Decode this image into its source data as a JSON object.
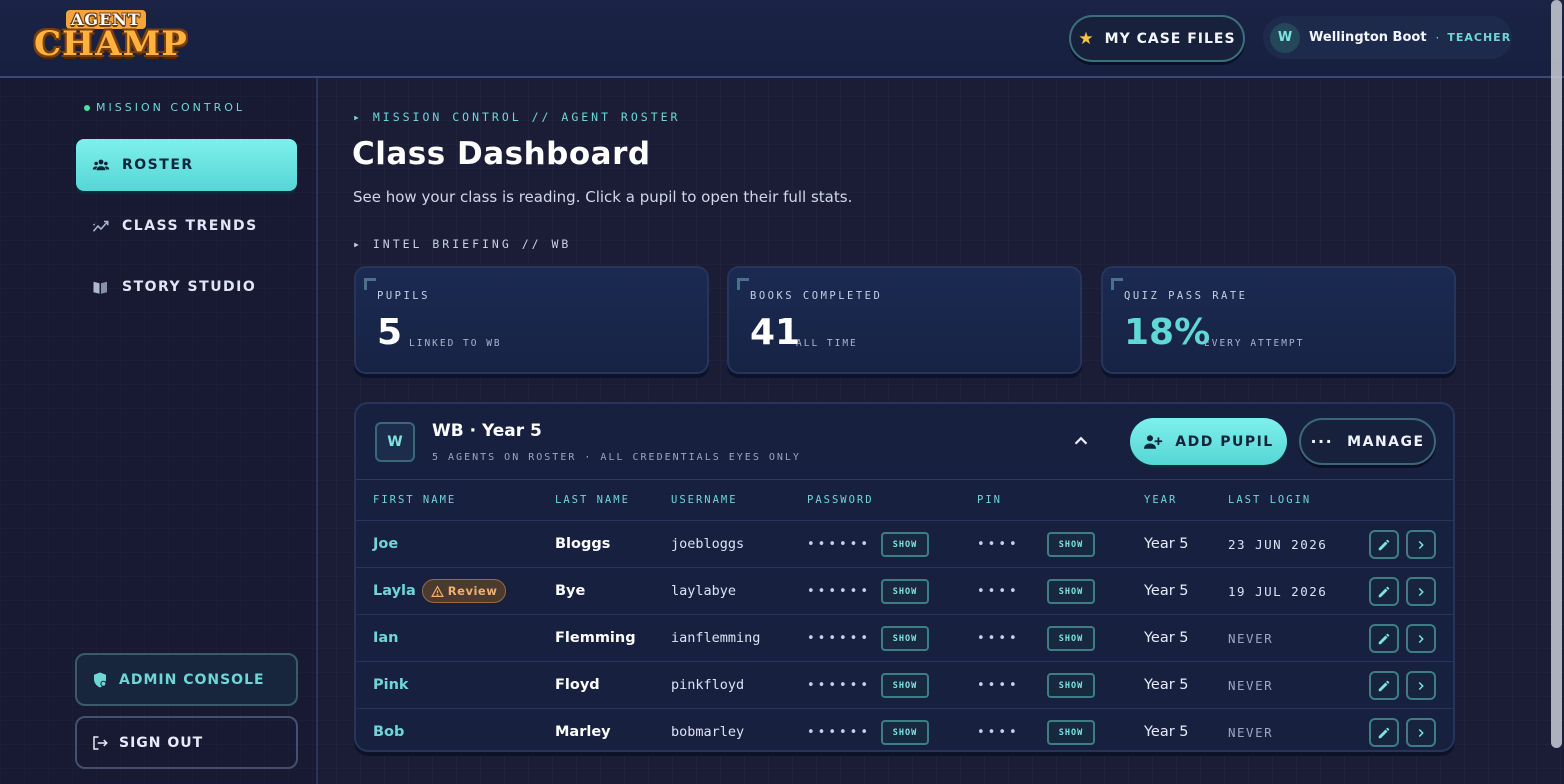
{
  "brand": {
    "logo_top": "AGENT",
    "logo_bottom": "CHAMP"
  },
  "header": {
    "case_files_label": "MY CASE FILES",
    "user_initial": "W",
    "user_name": "Wellington Boot",
    "separator": "·",
    "user_role": "TEACHER"
  },
  "sidebar": {
    "heading": "MISSION CONTROL",
    "items": [
      {
        "label": "ROSTER",
        "icon": "users-icon",
        "active": true
      },
      {
        "label": "CLASS TRENDS",
        "icon": "trend-icon",
        "active": false
      },
      {
        "label": "STORY STUDIO",
        "icon": "book-icon",
        "active": false
      }
    ],
    "admin_label": "ADMIN CONSOLE",
    "signout_label": "SIGN OUT"
  },
  "main": {
    "breadcrumb": "▸ MISSION CONTROL // AGENT ROSTER",
    "title": "Class Dashboard",
    "subtitle": "See how your class is reading. Click a pupil to open their full stats.",
    "intel_heading": "▸ INTEL BRIEFING // WB"
  },
  "stats": [
    {
      "label": "PUPILS",
      "value": "5",
      "sub": "LINKED TO WB"
    },
    {
      "label": "BOOKS COMPLETED",
      "value": "41",
      "sub": "ALL TIME"
    },
    {
      "label": "QUIZ PASS RATE",
      "value": "18%",
      "sub": "EVERY ATTEMPT"
    }
  ],
  "class_panel": {
    "badge": "W",
    "title": "WB · Year 5",
    "subtitle": "5 AGENTS ON ROSTER · ALL CREDENTIALS EYES ONLY",
    "add_label": "ADD PUPIL",
    "manage_label": "MANAGE",
    "columns": [
      "FIRST NAME",
      "LAST NAME",
      "USERNAME",
      "PASSWORD",
      "PIN",
      "YEAR",
      "LAST LOGIN"
    ],
    "show_label": "SHOW",
    "password_mask": "••••••",
    "pin_mask": "••••",
    "rows": [
      {
        "first": "Joe",
        "last": "Bloggs",
        "username": "joebloggs",
        "year": "Year 5",
        "last_login": "23 JUN 2026",
        "review": null
      },
      {
        "first": "Layla",
        "last": "Bye",
        "username": "laylabye",
        "year": "Year 5",
        "last_login": "19 JUL 2026",
        "review": "Review"
      },
      {
        "first": "Ian",
        "last": "Flemming",
        "username": "ianflemming",
        "year": "Year 5",
        "last_login": "NEVER",
        "review": null
      },
      {
        "first": "Pink",
        "last": "Floyd",
        "username": "pinkfloyd",
        "year": "Year 5",
        "last_login": "NEVER",
        "review": null
      },
      {
        "first": "Bob",
        "last": "Marley",
        "username": "bobmarley",
        "year": "Year 5",
        "last_login": "NEVER",
        "review": null
      }
    ]
  },
  "colors": {
    "accent": "#5fd8d6",
    "background": "#1a1d35",
    "warning": "#f2b06a"
  }
}
